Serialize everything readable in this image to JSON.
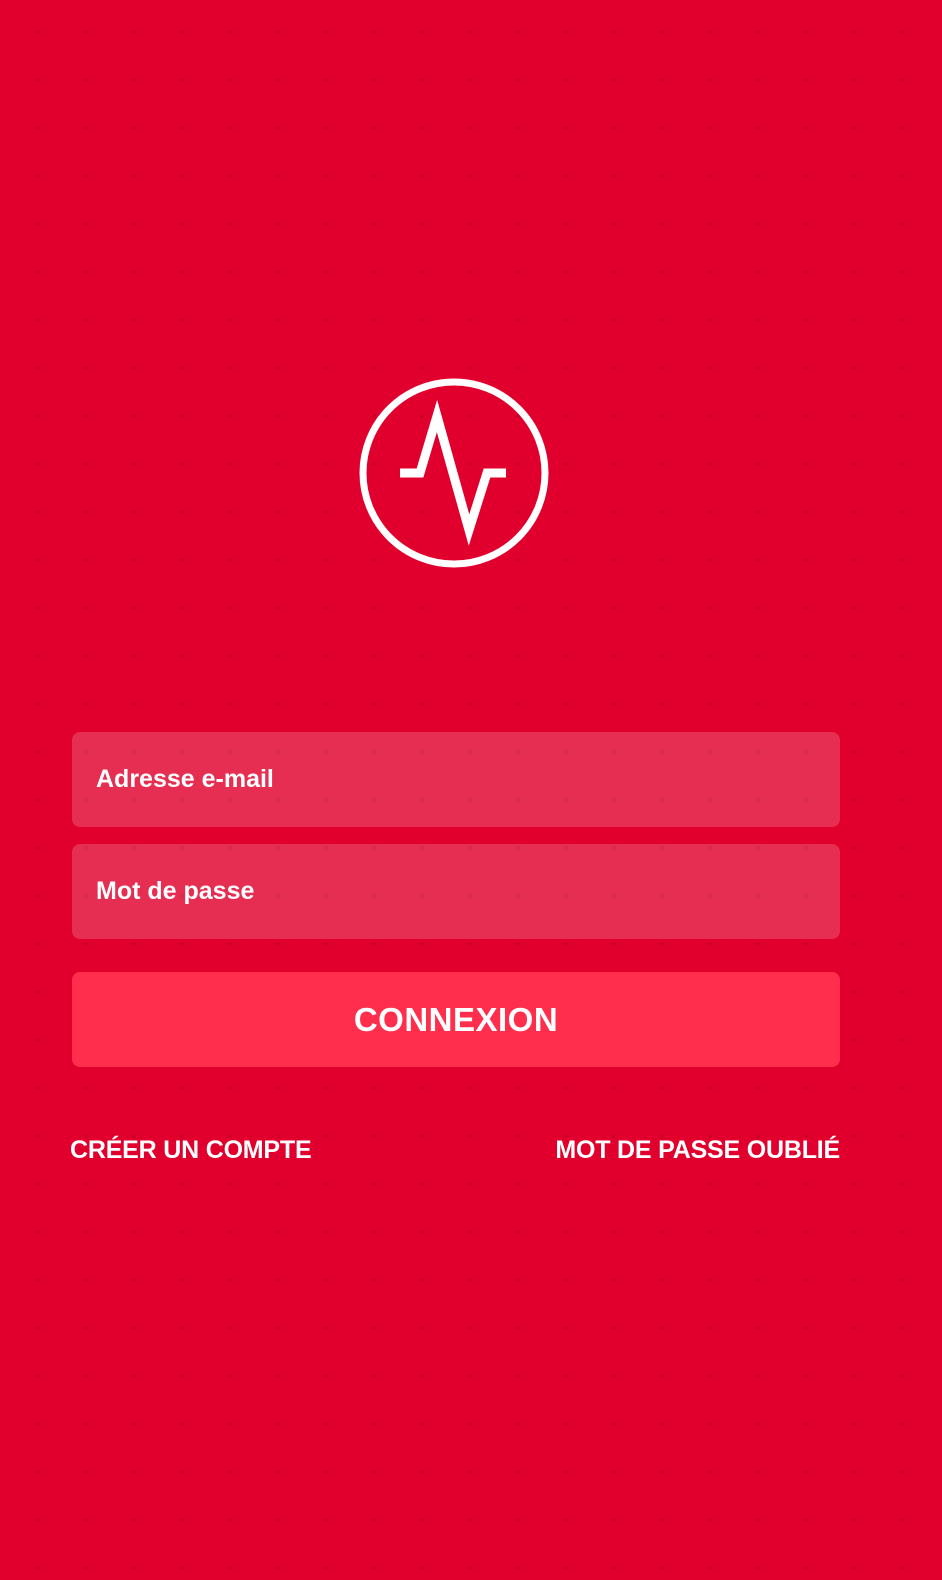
{
  "app": {
    "logo_icon": "pulse-heartbeat-icon",
    "background_color": "#e1002d",
    "accent_color": "#ff2e4d"
  },
  "login_form": {
    "email_placeholder": "Adresse e-mail",
    "password_placeholder": "Mot de passe",
    "submit_label": "CONNEXION"
  },
  "links": {
    "create_account": "CRÉER UN COMPTE",
    "forgot_password": "MOT DE PASSE OUBLIÉ"
  }
}
